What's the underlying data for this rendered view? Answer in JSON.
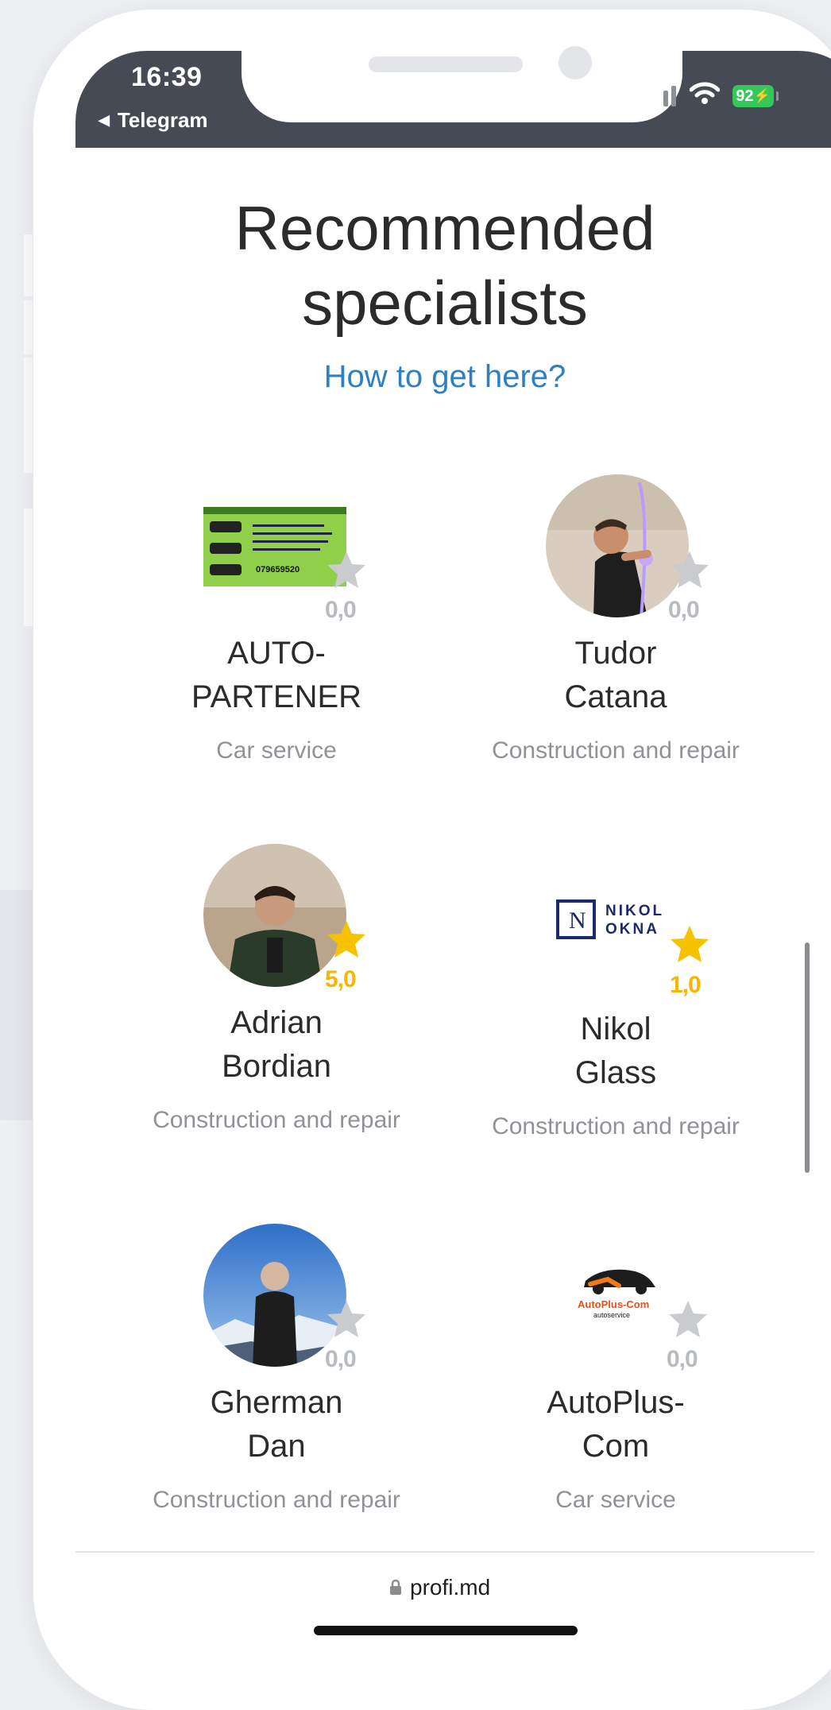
{
  "status_bar": {
    "time": "16:39",
    "back_app": "Telegram",
    "battery": "92",
    "icons": [
      "signal-icon",
      "wifi-icon",
      "battery-icon"
    ]
  },
  "page": {
    "title": "Recommended specialists",
    "how_link": "How to get here?"
  },
  "specialists": [
    {
      "name": "AUTO-PARTENER",
      "category": "Car service",
      "rating": "0,0",
      "stars": 0
    },
    {
      "name": "Tudor Catana",
      "category": "Construction and repair",
      "rating": "0,0",
      "stars": 0
    },
    {
      "name": "Adrian Bordian",
      "category": "Construction and repair",
      "rating": "5,0",
      "stars": 5
    },
    {
      "name": "Nikol Glass",
      "category": "Construction and repair",
      "rating": "1,0",
      "stars": 1
    },
    {
      "name": "Gherman Dan",
      "category": "Construction and repair",
      "rating": "0,0",
      "stars": 0
    },
    {
      "name": "AutoPlus-Com",
      "category": "Car service",
      "rating": "0,0",
      "stars": 0
    }
  ],
  "logos": {
    "nikol_mark": "N",
    "nikol_line1": "NIKOL",
    "nikol_line2": "OKNA",
    "autoplus_brand": "AutoPlus-Com",
    "autoplus_sub": "autoservice",
    "autopartener_phone": "079659520"
  },
  "browser": {
    "url": "profi.md"
  },
  "colors": {
    "accent_link": "#2f7fc3",
    "star_active": "#f6c200",
    "star_inactive": "#c9cbcf",
    "status_bar": "#454a55"
  }
}
